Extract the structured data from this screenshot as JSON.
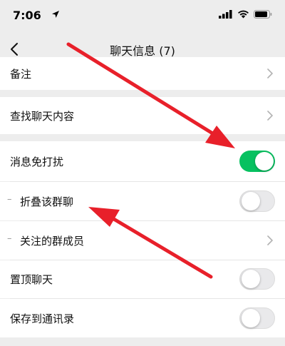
{
  "status_bar": {
    "time": "7:06",
    "icons": [
      "location-arrow-icon",
      "signal-icon",
      "wifi-icon",
      "battery-icon"
    ]
  },
  "nav": {
    "back_icon": "chevron-left-icon",
    "title": "聊天信息 (7)"
  },
  "rows": {
    "remark": {
      "label": "备注"
    },
    "search_history": {
      "label": "查找聊天内容"
    },
    "mute": {
      "label": "消息免打扰",
      "enabled": true
    },
    "fold_group": {
      "dash": "–",
      "label": "折叠该群聊",
      "enabled": false
    },
    "followed_members": {
      "dash": "–",
      "label": "关注的群成员"
    },
    "pin": {
      "label": "置顶聊天",
      "enabled": false
    },
    "save_contacts": {
      "label": "保存到通讯录",
      "enabled": false
    }
  },
  "colors": {
    "toggle_on": "#07c160",
    "annotation_arrow": "#e8202a",
    "background": "#ededed"
  }
}
